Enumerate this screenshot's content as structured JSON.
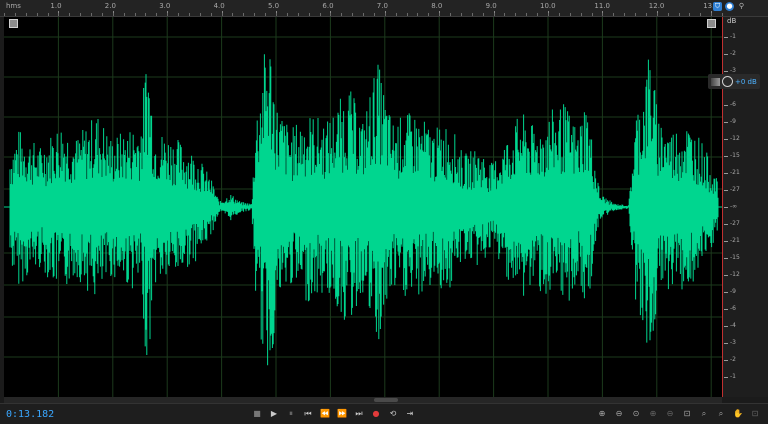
{
  "ruler": {
    "units_label": "hms",
    "time_labels": [
      "1.0",
      "2.0",
      "3.0",
      "4.0",
      "5.0",
      "6.0",
      "7.0",
      "8.0",
      "9.0",
      "10.0",
      "11.0",
      "12.0",
      "13.0"
    ]
  },
  "db_scale": {
    "title": "dB",
    "labels": [
      "-1",
      "-2",
      "-3",
      "-4",
      "-6",
      "-9",
      "-12",
      "-15",
      "-21",
      "-27",
      "-∞",
      "-27",
      "-21",
      "-15",
      "-12",
      "-9",
      "-6",
      "-4",
      "-3",
      "-2",
      "-1"
    ]
  },
  "gain_control": {
    "value": "+0 dB"
  },
  "transport": {
    "current_time": "0:13.182",
    "buttons": [
      "stop",
      "play",
      "pause",
      "skip-start",
      "rewind",
      "fast-forward",
      "skip-end",
      "record",
      "loop",
      "skip-selection"
    ]
  },
  "colors": {
    "waveform": "#00d68f",
    "background": "#000000",
    "playhead": "#c03030",
    "time_display": "#3aa7ff"
  },
  "icons": {
    "stop": "■",
    "play": "▶",
    "pause": "⏸",
    "skip_start": "⏮",
    "rewind": "⏪",
    "fast_forward": "⏩",
    "skip_end": "⏭",
    "record": "●",
    "loop": "⟲",
    "skip_selection": "⇥",
    "zoom_in_amp": "⊕",
    "zoom_out_amp": "⊖",
    "zoom_full": "⊙",
    "zoom_in_time": "⊕",
    "zoom_out_time": "⊖",
    "zoom_sel": "⊡",
    "hand": "✋",
    "extra": "⌕"
  }
}
